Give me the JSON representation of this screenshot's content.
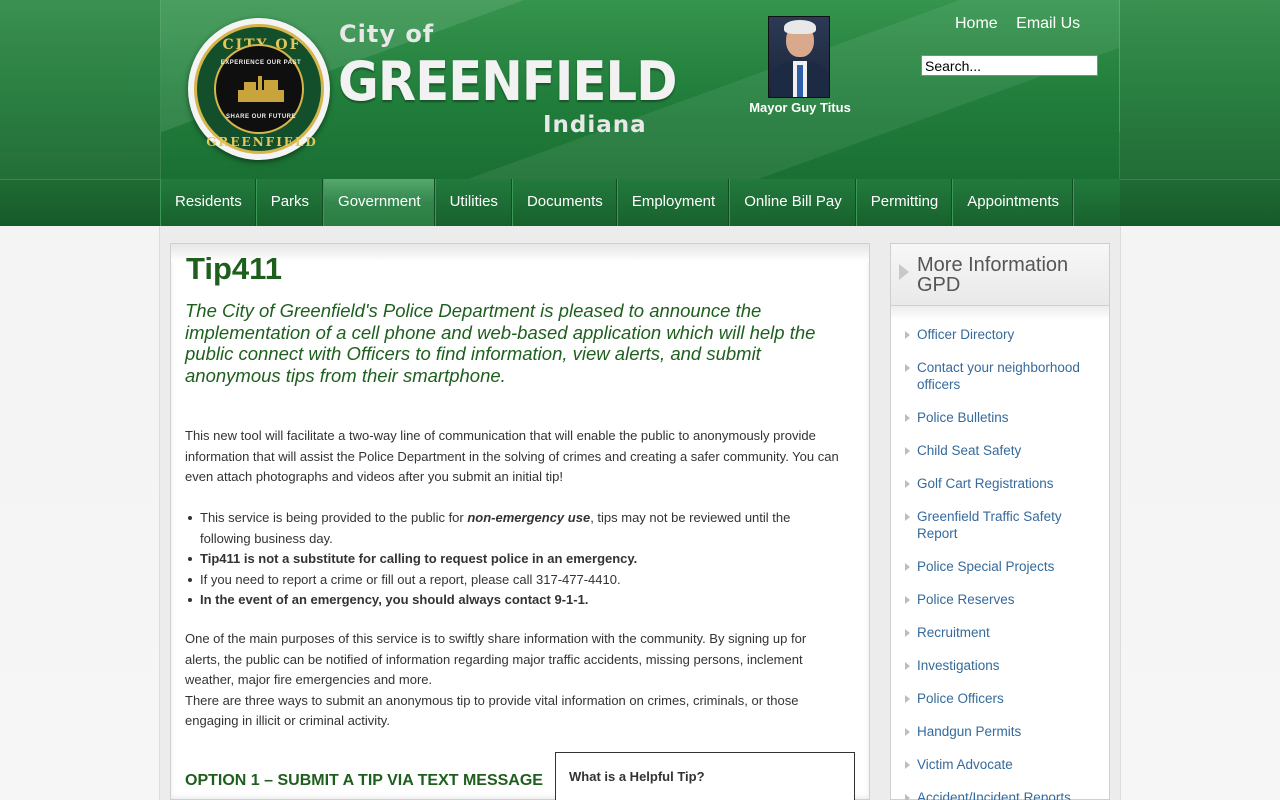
{
  "header": {
    "seal": {
      "top_text": "CITY OF",
      "bottom_text": "GREENFIELD",
      "motto_top": "EXPERIENCE OUR PAST",
      "motto_bottom": "SHARE OUR FUTURE"
    },
    "wordmark": {
      "city_of": "City of",
      "name": "GREENFIELD",
      "state": "Indiana"
    },
    "mayor_caption": "Mayor Guy Titus",
    "top_links": [
      "Home",
      "Email Us"
    ],
    "search": {
      "value": "Search..."
    }
  },
  "nav": {
    "items": [
      "Residents",
      "Parks",
      "Government",
      "Utilities",
      "Documents",
      "Employment",
      "Online Bill Pay",
      "Permitting",
      "Appointments"
    ],
    "active": "Government"
  },
  "main": {
    "title": "Tip411",
    "lead": "The City of Greenfield's Police Department is pleased to announce the implementation of a cell phone and web-based application which will help the public connect with Officers to find information, view alerts, and submit anonymous tips from their smartphone.",
    "p1": "This new tool will facilitate a two-way line of communication that will enable the public to anonymously provide information that will assist the Police Department in the solving of crimes and creating a safer community. You can even attach photographs and videos after you submit an initial tip!",
    "bullets": {
      "b1_pre": "This service is being provided to the public for ",
      "b1_em": "non-emergency use",
      "b1_post": ", tips may not be reviewed until the following business day.",
      "b2": "Tip411 is not a substitute for calling to request police in an emergency.",
      "b3": "If you need to report a crime or fill out a report, please call 317-477-4410.",
      "b4": "In the event of an emergency, you should always contact 9-1-1."
    },
    "p2a": "One of the main purposes of this service is to swiftly share information with the community. By signing up for alerts, the public can be notified of information regarding major traffic accidents, missing persons, inclement weather, major fire emergencies and more.",
    "p2b": "There are three ways to submit an anonymous tip to provide vital information on crimes, criminals, or those engaging in illicit or criminal activity.",
    "option1_heading": "OPTION 1 – SUBMIT A TIP VIA TEXT MESSAGE",
    "tip_box_title": "What is a Helpful Tip?"
  },
  "sidebar": {
    "title": "More Information GPD",
    "items": [
      "Officer Directory",
      "Contact your neighborhood officers",
      "Police Bulletins",
      "Child Seat Safety",
      "Golf Cart Registrations",
      "Greenfield Traffic Safety Report",
      "Police Special Projects",
      "Police Reserves",
      "Recruitment",
      "Investigations",
      "Police Officers",
      "Handgun Permits",
      "Victim Advocate",
      "Accident/Incident Reports"
    ]
  },
  "colors": {
    "header_green": "#227f3c",
    "title_green": "#1e5f1e",
    "link_blue": "#356a9c",
    "nav_active": "#33874c"
  }
}
